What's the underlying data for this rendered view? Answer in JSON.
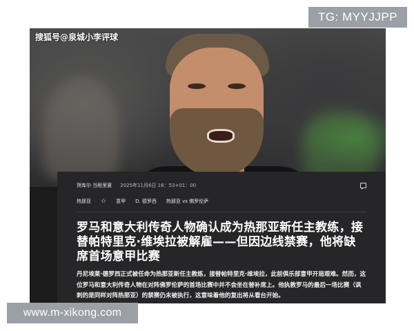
{
  "overlay": {
    "tg_label": "TG: MYYJJPP",
    "site_label": "www.m-xikong.com"
  },
  "photo": {
    "watermark": "搜狐号@泉城小李评球"
  },
  "article": {
    "author": "贺库尔·当租里夏",
    "timestamp": "2025年11月6日 16：53+01：00",
    "tags": [
      "热那亚",
      "意甲",
      "D. 德罗西",
      "热那亚 vs 佛罗伦萨"
    ],
    "headline": "罗马和意大利传奇人物确认成为热那亚新任主教练，接替帕特里克·维埃拉被解雇——但因边线禁赛，他将缺席首场意甲比赛",
    "body": "丹尼埃莱·德罗西正式被任命为热那亚新任主教练，接替帕特里克·维埃拉，此前俱乐部意甲开局艰难。然而，这位罗马和意大利传奇人物在对阵佛罗伦萨的首场比赛中并不会坐在替补席上。他执教罗马的最后一场比赛（讽刺的是同样对阵热那亚）的禁赛仍未被执行，这意味着他的复出将从看台开始。"
  },
  "colors": {
    "card_bg": "#262628",
    "frame_bg": "#1b1b1c",
    "badge_bg": "#9aa0a6"
  }
}
